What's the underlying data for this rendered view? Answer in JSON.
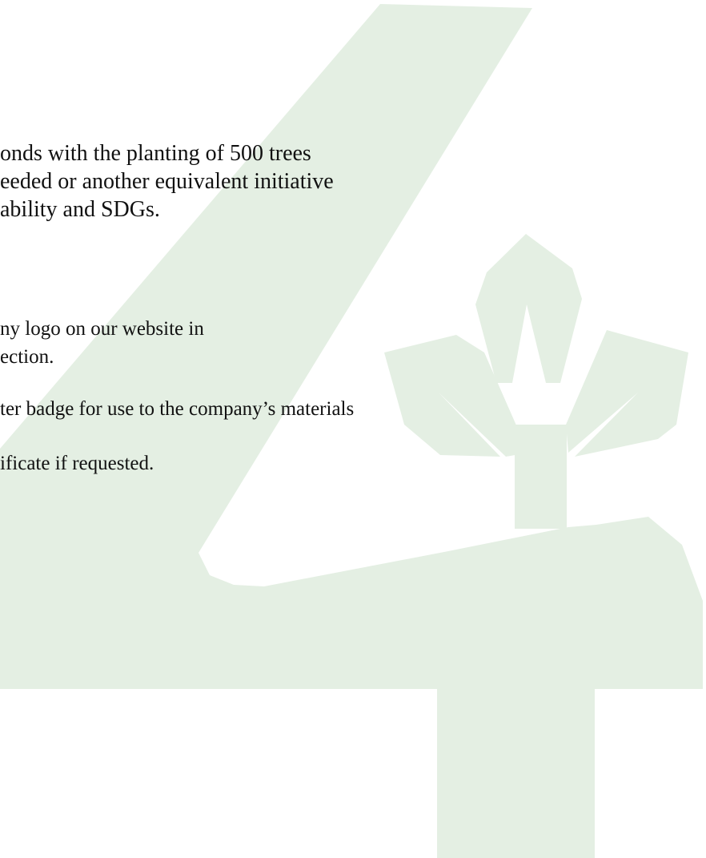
{
  "document": {
    "lines": [
      "onds with the planting of 500 trees",
      "eeded or another equivalent initiative",
      "ability and SDGs.",
      "ny logo on our website in",
      "ection.",
      "ter badge for use to the company’s materials",
      "ificate if requested."
    ]
  },
  "watermark": {
    "color": "#e4efe3",
    "depicts": "numeral 4 with sprouting plant"
  }
}
